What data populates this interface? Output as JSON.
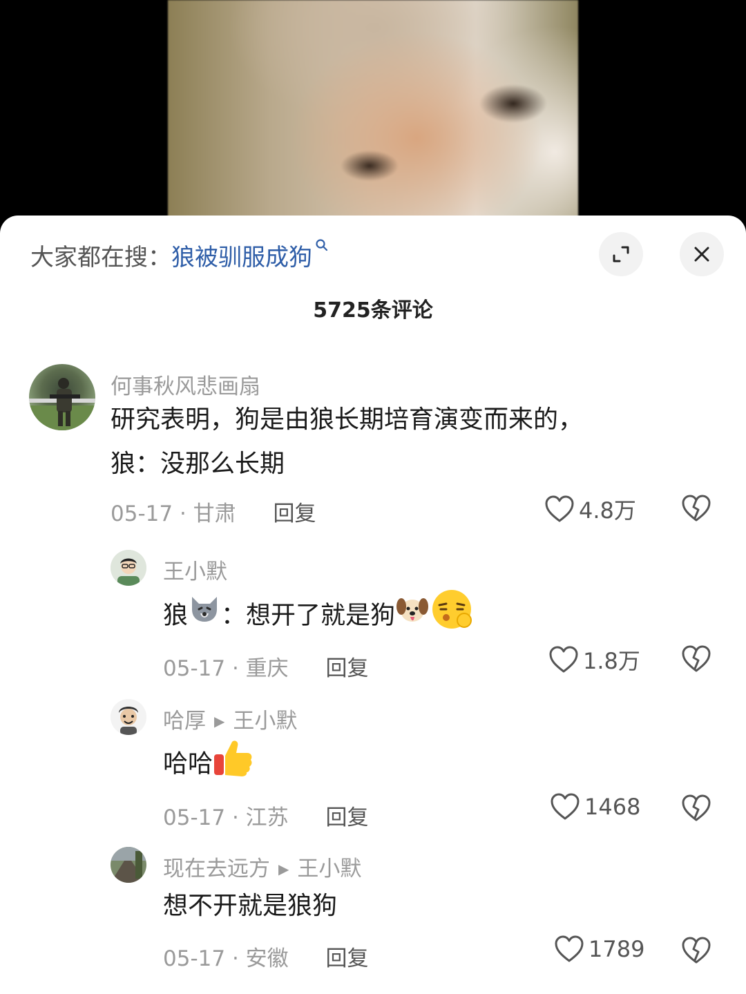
{
  "search": {
    "label": "大家都在搜：",
    "term": "狼被驯服成狗"
  },
  "comment_count": "5725条评论",
  "comments": [
    {
      "author": "何事秋风悲画扇",
      "text_line1": "研究表明，狗是由狼长期培育演变而来的，",
      "text_line2": "狼：没那么长期",
      "date": "05-17",
      "region": "甘肃",
      "reply": "回复",
      "likes": "4.8万"
    },
    {
      "author": "王小默",
      "text_a": "狼",
      "text_b": "：想开了就是狗",
      "date": "05-17",
      "region": "重庆",
      "reply": "回复",
      "likes": "1.8万"
    },
    {
      "author": "哈厚",
      "reply_to": "王小默",
      "text": "哈哈",
      "date": "05-17",
      "region": "江苏",
      "reply": "回复",
      "likes": "1468"
    },
    {
      "author": "现在去远方",
      "reply_to": "王小默",
      "text": "想不开就是狼狗",
      "date": "05-17",
      "region": "安徽",
      "reply": "回复",
      "likes": "1789"
    }
  ],
  "icons": {
    "search": "search-icon",
    "expand": "expand-icon",
    "close": "close-icon",
    "like": "heart-outline-icon",
    "dislike": "broken-heart-icon",
    "emoji_wolf": "wolf-emoji-icon",
    "emoji_dog": "dog-emoji-icon",
    "emoji_face": "pouting-face-emoji-icon",
    "emoji_thumbs": "thumbs-up-emoji-icon"
  },
  "colors": {
    "search_term": "#2f5ea8",
    "meta_gray": "#9a9a9a",
    "sheet_bg": "#ffffff"
  }
}
